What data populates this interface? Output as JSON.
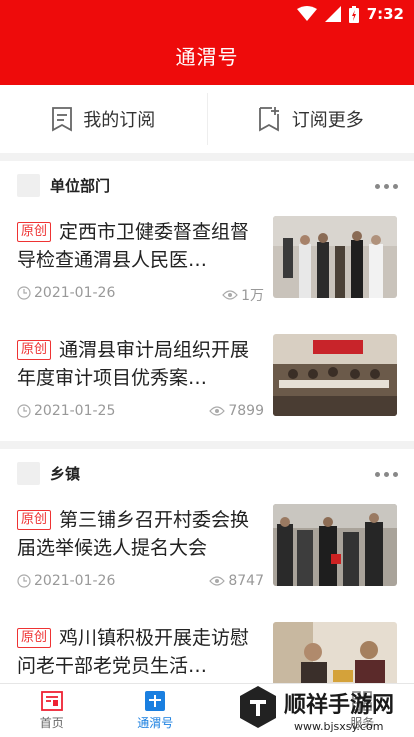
{
  "status_bar": {
    "time": "7:32"
  },
  "header": {
    "title": "通渭号"
  },
  "top_tabs": [
    {
      "label": "我的订阅",
      "icon": "bookmark-icon"
    },
    {
      "label": "订阅更多",
      "icon": "bookmark-add-icon"
    }
  ],
  "sections": [
    {
      "title": "单位部门",
      "articles": [
        {
          "badge": "原创",
          "title": "定西市卫健委督查组督导检查通渭县人民医…",
          "date": "2021-01-26",
          "views": "1万"
        },
        {
          "badge": "原创",
          "title": "通渭县审计局组织开展年度审计项目优秀案…",
          "date": "2021-01-25",
          "views": "7899"
        }
      ]
    },
    {
      "title": "乡镇",
      "articles": [
        {
          "badge": "原创",
          "title": "第三铺乡召开村委会换届选举候选人提名大会",
          "date": "2021-01-26",
          "views": "8747"
        },
        {
          "badge": "原创",
          "title": "鸡川镇积极开展走访慰问老干部老党员生活…",
          "date": "",
          "views": ""
        }
      ]
    }
  ],
  "bottom_nav": [
    {
      "label": "首页",
      "icon": "news-icon"
    },
    {
      "label": "通渭号",
      "icon": "channel-icon"
    },
    {
      "label": "",
      "icon": "plus-icon"
    },
    {
      "label": "服务",
      "icon": "service-icon"
    }
  ],
  "watermark": {
    "brand": "顺祥手游网",
    "url": "www.bjsxsy.com"
  },
  "colors": {
    "brand_red": "#ee0b0b",
    "active_blue": "#1a7fe0",
    "badge_red": "#ee3333"
  }
}
